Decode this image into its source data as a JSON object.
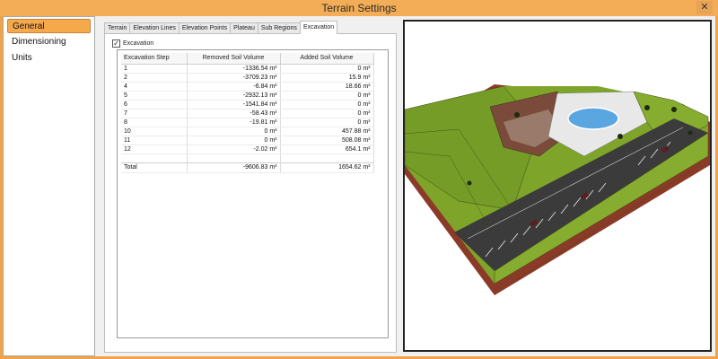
{
  "window": {
    "title": "Terrain Settings",
    "close_icon": "close-icon"
  },
  "nav": {
    "items": [
      {
        "label": "General",
        "selected": true
      },
      {
        "label": "Dimensioning",
        "selected": false
      },
      {
        "label": "Units",
        "selected": false
      }
    ]
  },
  "tabs": [
    "Terrain",
    "Elevation Lines",
    "Elevation Points",
    "Plateau",
    "Sub Regions",
    "Excavation"
  ],
  "active_tab": "Excavation",
  "excavation": {
    "checkbox_label": "Excavation",
    "checked": true,
    "columns": [
      "Excavation Step",
      "Removed Soil Volume",
      "Added Soil Volume"
    ],
    "rows": [
      [
        "1",
        "-1336.54 m³",
        "0 m³"
      ],
      [
        "2",
        "-3709.23 m³",
        "15.9 m³"
      ],
      [
        "4",
        "-6.84 m³",
        "18.66 m³"
      ],
      [
        "5",
        "-2932.13 m³",
        "0 m³"
      ],
      [
        "6",
        "-1541.84 m³",
        "0 m³"
      ],
      [
        "7",
        "-58.43 m³",
        "0 m³"
      ],
      [
        "8",
        "-19.81 m³",
        "0 m³"
      ],
      [
        "10",
        "0 m³",
        "457.88 m³"
      ],
      [
        "11",
        "0 m³",
        "508.08 m³"
      ],
      [
        "12",
        "-2.02 m³",
        "654.1 m³"
      ]
    ],
    "total": [
      "Total",
      "-9606.83 m³",
      "1654.62 m³"
    ]
  },
  "colors": {
    "accent": "#f0a44a",
    "grass": "#7ea52a",
    "soil": "#8c3a28",
    "asphalt": "#3b3b3b",
    "water": "#5aa6e0"
  }
}
